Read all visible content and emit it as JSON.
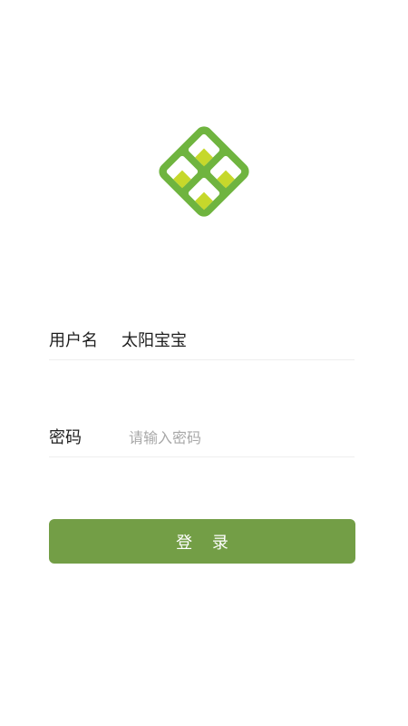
{
  "colors": {
    "brand_green": "#739e46",
    "logo_green": "#6fb43f",
    "logo_accent": "#c6d82b",
    "divider": "#eeeeee",
    "placeholder": "#a8a8a8"
  },
  "logo": {
    "icon": "app-logo-diamond-icon"
  },
  "form": {
    "username": {
      "label": "用户名",
      "value": "太阳宝宝"
    },
    "password": {
      "label": "密码",
      "placeholder": "请输入密码",
      "value": ""
    },
    "submit_label": "登 录"
  }
}
